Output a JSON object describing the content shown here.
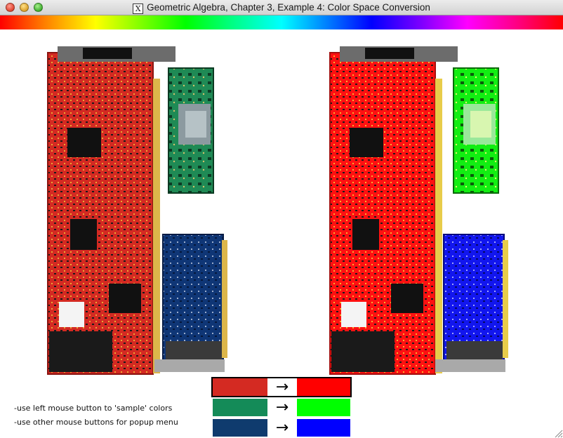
{
  "window": {
    "title": "Geometric Algebra, Chapter 3, Example 4: Color Space Conversion",
    "title_icon": "X"
  },
  "panels": {
    "original": {
      "role": "source image of circuit boards",
      "board_colors": {
        "red_board": "#d42a22",
        "green_board": "#1f8a55",
        "blue_board": "#0f3676"
      }
    },
    "converted": {
      "role": "converted image of circuit boards",
      "board_colors": {
        "red_board": "#ff1111",
        "green_board": "#12ee12",
        "blue_board": "#1216ee"
      }
    }
  },
  "color_mappings": [
    {
      "source": "#d42a22",
      "arrow": "→",
      "target": "#ff0000",
      "selected": true
    },
    {
      "source": "#148b58",
      "arrow": "→",
      "target": "#00ff00",
      "selected": false
    },
    {
      "source": "#0f3b6e",
      "arrow": "→",
      "target": "#0000ff",
      "selected": false
    }
  ],
  "instructions": {
    "line1": "-use left mouse button to 'sample' colors",
    "line2": "-use other mouse buttons for popup menu"
  }
}
